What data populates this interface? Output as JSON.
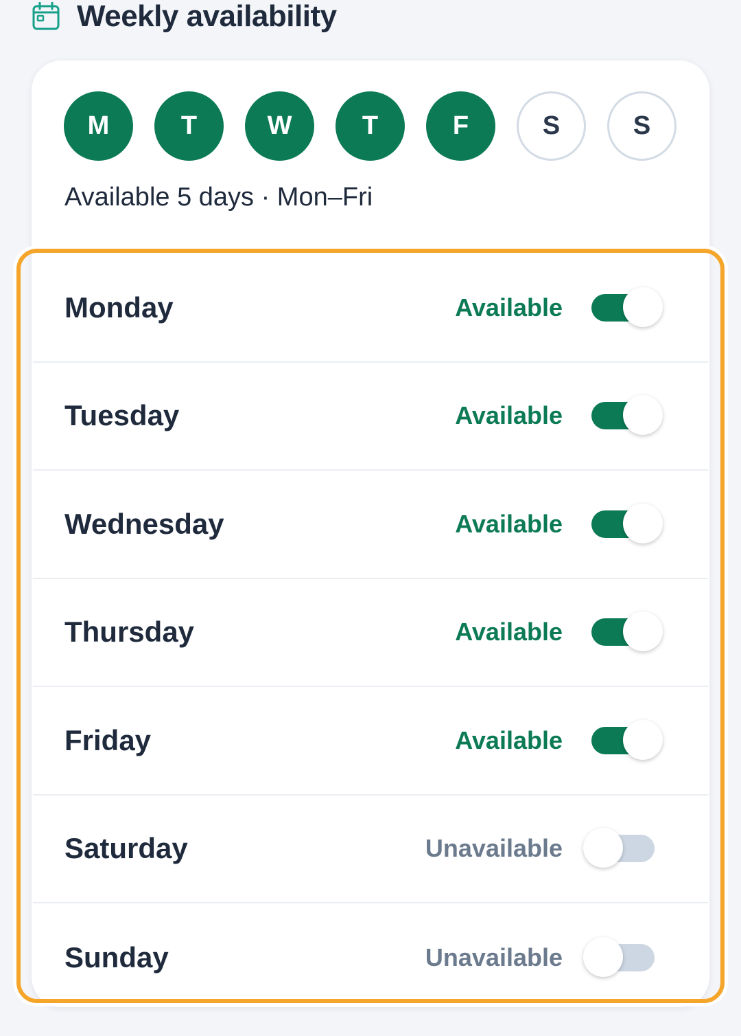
{
  "header": {
    "title": "Weekly availability",
    "icon": "calendar-icon"
  },
  "day_chips": [
    {
      "letter": "M",
      "selected": true
    },
    {
      "letter": "T",
      "selected": true
    },
    {
      "letter": "W",
      "selected": true
    },
    {
      "letter": "T",
      "selected": true
    },
    {
      "letter": "F",
      "selected": true
    },
    {
      "letter": "S",
      "selected": false
    },
    {
      "letter": "S",
      "selected": false
    }
  ],
  "summary": "Available 5 days · Mon–Fri",
  "rows": [
    {
      "day": "Monday",
      "status": "Available",
      "on": true
    },
    {
      "day": "Tuesday",
      "status": "Available",
      "on": true
    },
    {
      "day": "Wednesday",
      "status": "Available",
      "on": true
    },
    {
      "day": "Thursday",
      "status": "Available",
      "on": true
    },
    {
      "day": "Friday",
      "status": "Available",
      "on": true
    },
    {
      "day": "Saturday",
      "status": "Unavailable",
      "on": false
    },
    {
      "day": "Sunday",
      "status": "Unavailable",
      "on": false
    }
  ],
  "colors": {
    "accent": "#0b7a55",
    "highlight": "#f4a52a",
    "toggle_off": "#cdd6e3",
    "muted_text": "#6b7a8d"
  }
}
